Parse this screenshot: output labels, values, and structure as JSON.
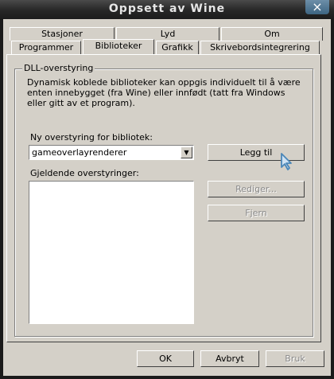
{
  "window": {
    "title": "Oppsett av Wine"
  },
  "tabs": {
    "row_top": [
      "Stasjoner",
      "Lyd",
      "Om"
    ],
    "row_bottom": [
      "Programmer",
      "Biblioteker",
      "Grafikk",
      "Skrivebordsintegrering"
    ],
    "active": "Biblioteker"
  },
  "dll": {
    "group_title": "DLL-overstyring",
    "description": "Dynamisk koblede biblioteker kan oppgis individuelt til å være enten innebygget (fra Wine) eller innfødt (tatt fra Windows eller gitt av et program).",
    "new_override_label": "Ny overstyring for bibliotek:",
    "combo_value": "gameoverlayrenderer",
    "current_overrides_label": "Gjeldende overstyringer:",
    "add_label": "Legg til",
    "edit_label": "Rediger...",
    "remove_label": "Fjern"
  },
  "footer": {
    "ok_label": "OK",
    "cancel_label": "Avbryt",
    "apply_label": "Bruk"
  },
  "icons": {
    "close": "close-icon",
    "dropdown": "chevron-down-icon",
    "cursor": "mouse-pointer-icon"
  }
}
